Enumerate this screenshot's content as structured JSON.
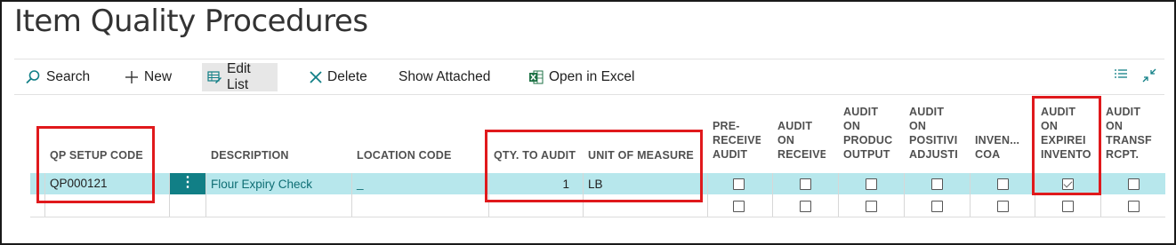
{
  "page": {
    "title": "Item Quality Procedures"
  },
  "toolbar": {
    "search": "Search",
    "new": "New",
    "edit_list": "Edit List",
    "delete": "Delete",
    "show_attached": "Show Attached",
    "open_excel": "Open in Excel"
  },
  "columns": {
    "qp_setup_code": "QP SETUP CODE",
    "description": "DESCRIPTION",
    "location_code": "LOCATION CODE",
    "qty_to_audit": "QTY. TO AUDIT",
    "unit_of_measure": "UNIT OF MEASURE",
    "pre_receive_audit": "PRE-\nRECEIVE\nAUDIT",
    "audit_on_receive": "AUDIT\nON\nRECEIVE",
    "audit_on_product_output": "AUDIT\nON\nPRODUC\nOUTPUT",
    "audit_on_positive_adjust": "AUDIT\nON\nPOSITIVI\nADJUSTI",
    "inventory_coa": "INVEN...\nCOA",
    "audit_on_expired_inventory": "AUDIT\nON\nEXPIREI\nINVENTO",
    "audit_on_transfer_rcpt": "AUDIT\nON\nTRANSF\nRCPT."
  },
  "rows": [
    {
      "qp_setup_code": "QP000121",
      "description": "Flour Expiry Check",
      "location_code": "_",
      "qty_to_audit": "1",
      "unit_of_measure": "LB",
      "pre_receive_audit": false,
      "audit_on_receive": false,
      "audit_on_product_output": false,
      "audit_on_positive_adjust": false,
      "inventory_coa": false,
      "audit_on_expired_inventory": true,
      "audit_on_transfer_rcpt": false
    },
    {
      "qp_setup_code": "",
      "description": "",
      "location_code": "",
      "qty_to_audit": "",
      "unit_of_measure": "",
      "pre_receive_audit": false,
      "audit_on_receive": false,
      "audit_on_product_output": false,
      "audit_on_positive_adjust": false,
      "inventory_coa": false,
      "audit_on_expired_inventory": false,
      "audit_on_transfer_rcpt": false
    }
  ],
  "row_actions": {
    "menu_glyph": "⋮"
  },
  "colors": {
    "accent": "#117f86",
    "selected_row": "#b7e7ec",
    "highlight_box": "#e0191c"
  }
}
